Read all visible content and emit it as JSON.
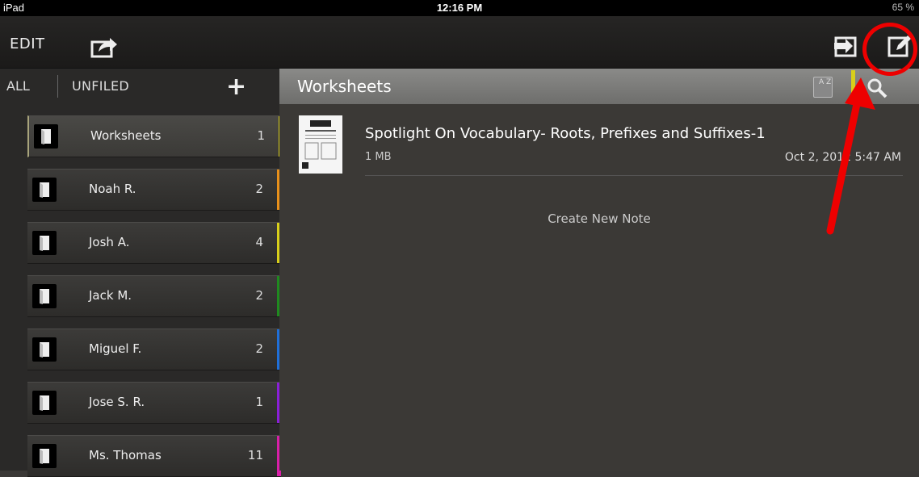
{
  "status_bar": {
    "device": "iPad",
    "time": "12:16 PM",
    "battery": "65 %"
  },
  "toolbar": {
    "edit_label": "EDIT",
    "share_icon": "share-icon",
    "import_icon": "import-icon",
    "compose_icon": "compose-note-icon"
  },
  "sidebar": {
    "tab_all": "ALL",
    "tab_unfiled": "UNFILED",
    "add_label": "+",
    "notebooks": [
      {
        "name": "Worksheets",
        "count": "1",
        "color": "#d8cf1a",
        "selected": true
      },
      {
        "name": "Noah R.",
        "count": "2",
        "color": "#e8901a"
      },
      {
        "name": "Josh A.",
        "count": "4",
        "color": "#d8cf1a"
      },
      {
        "name": "Jack M.",
        "count": "2",
        "color": "#1f8a1f"
      },
      {
        "name": "Miguel F.",
        "count": "2",
        "color": "#1f6fd8"
      },
      {
        "name": "Jose S. R.",
        "count": "1",
        "color": "#8a1fd8"
      },
      {
        "name": "Ms. Thomas",
        "count": "11",
        "color": "#d81fa8"
      }
    ]
  },
  "main": {
    "title": "Worksheets",
    "sort_label": "A Z",
    "notes": [
      {
        "title": "Spotlight On Vocabulary- Roots, Prefixes and Suffixes-1",
        "size": "1 MB",
        "date": "Oct 2, 2012 5:47 AM"
      }
    ],
    "create_note_label": "Create New Note"
  },
  "colors": {
    "annotation": "#e00000",
    "highlight_tab": "#d8cf1a"
  }
}
